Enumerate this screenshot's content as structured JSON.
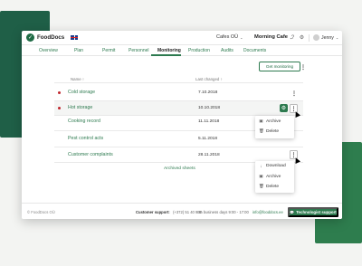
{
  "app": {
    "logo_text": "FoodDocs",
    "logo_glyph": "✓"
  },
  "header": {
    "company": "Cafes OÜ",
    "location": "Morning Cafe",
    "user": "Jenny",
    "chevron": "⌄",
    "help_glyph": "?",
    "settings_glyph": "⚙",
    "bell_glyph": "🔔"
  },
  "tabs": [
    "Overview",
    "Plan",
    "Permit",
    "Personnel",
    "Monitoring",
    "Production",
    "Audits",
    "Documents"
  ],
  "actions": {
    "get_monitoring": "Get monitoring",
    "more_glyph": "⋮"
  },
  "table": {
    "col_name": "Name ↑",
    "col_changed": "Last changed ↑",
    "rows": [
      {
        "name": "Cold storage",
        "date": "7.10.2018",
        "alert": true
      },
      {
        "name": "Hot storage",
        "date": "10.10.2018",
        "alert": true
      },
      {
        "name": "Cooking record",
        "date": "11.11.2018",
        "alert": false
      },
      {
        "name": "Pest control acts",
        "date": "5.11.2018",
        "alert": false
      },
      {
        "name": "Customer complaints",
        "date": "28.11.2018",
        "alert": false
      }
    ],
    "archived_link": "Archived sheets",
    "settings_glyph": "⚙"
  },
  "menu1": {
    "items": [
      {
        "icon": "▣",
        "label": "Archive"
      },
      {
        "icon": "🗑",
        "label": "Delete"
      }
    ]
  },
  "menu2": {
    "items": [
      {
        "icon": "↓",
        "label": "Download"
      },
      {
        "icon": "▣",
        "label": "Archive"
      },
      {
        "icon": "🗑",
        "label": "Delete"
      }
    ]
  },
  "footer": {
    "copyright": "© FoodDocs OÜ",
    "support_label": "Customer support:",
    "phone": "(+372) 51 40 930",
    "hours": "On business days 9:00 - 17:00",
    "email": "info@fooddocs.ee",
    "tech_button": "Technologist support",
    "tech_glyph": "💬"
  },
  "colors": {
    "brand": "#2d7a4f",
    "alert": "#c0262d",
    "deco_dark": "#1f5f47"
  }
}
